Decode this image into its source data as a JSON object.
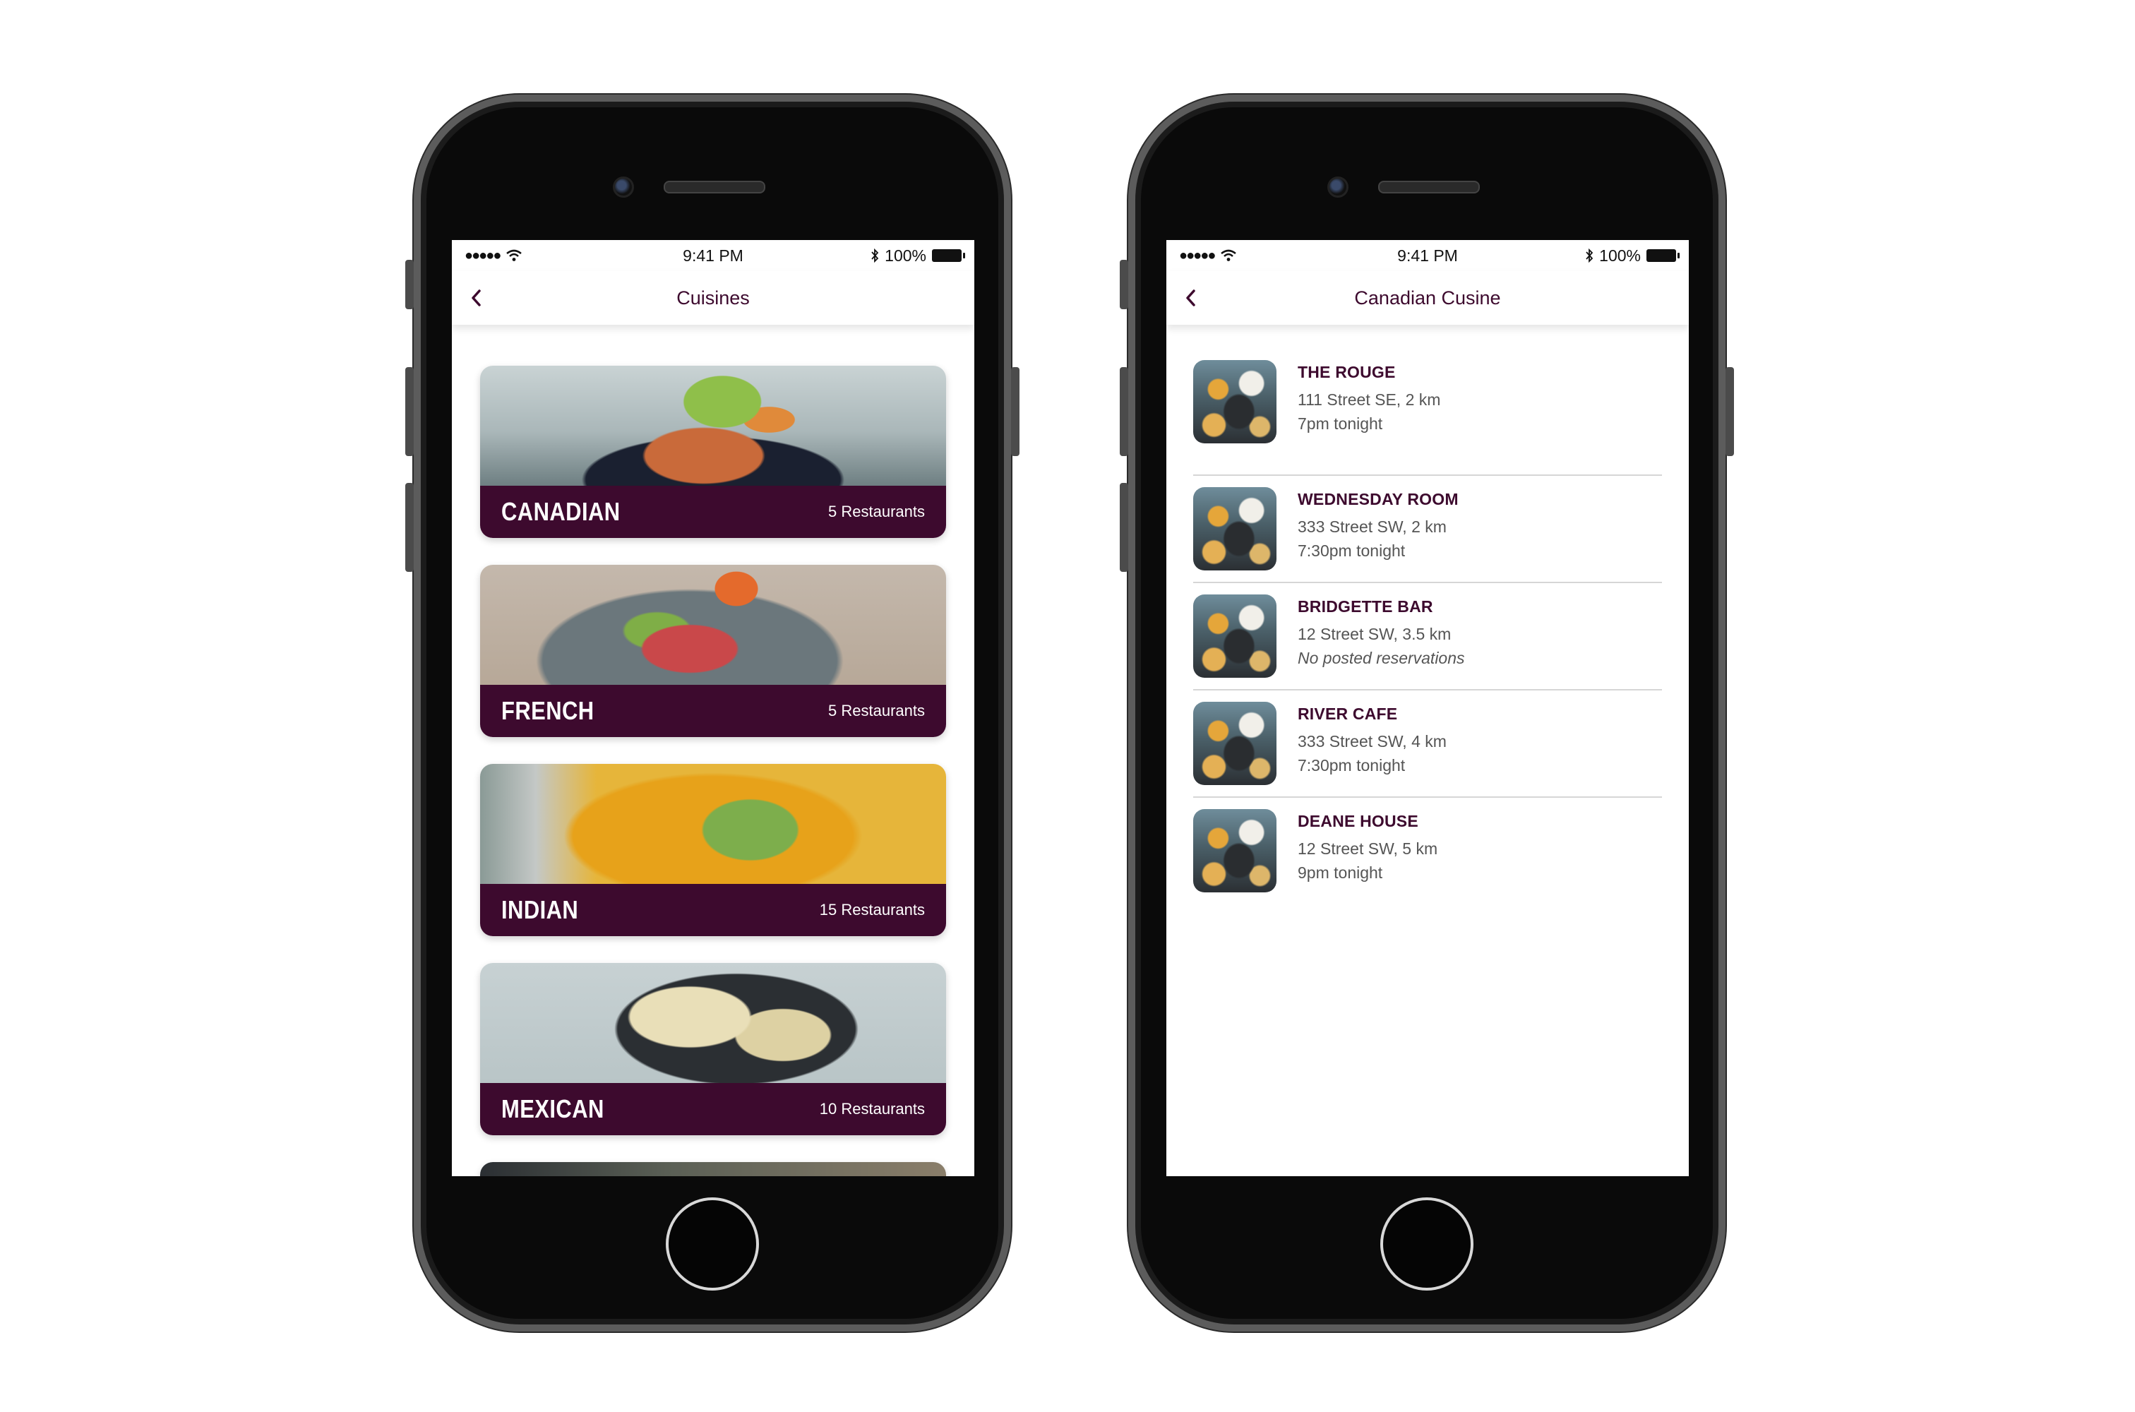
{
  "status_bar": {
    "signal": "●●●●●",
    "time": "9:41 PM",
    "battery": "100%"
  },
  "cuisines_screen": {
    "title": "Cuisines",
    "cards": [
      {
        "name": "CANADIAN",
        "count": "5 Restaurants"
      },
      {
        "name": "FRENCH",
        "count": "5 Restaurants"
      },
      {
        "name": "INDIAN",
        "count": "15 Restaurants"
      },
      {
        "name": "MEXICAN",
        "count": "10 Restaurants"
      }
    ]
  },
  "restaurants_screen": {
    "title": "Canadian Cusine",
    "restaurants": [
      {
        "name": "THE ROUGE",
        "address": "111 Street SE, 2 km",
        "time": "7pm tonight"
      },
      {
        "name": "WEDNESDAY ROOM",
        "address": "333 Street SW, 2 km",
        "time": "7:30pm tonight"
      },
      {
        "name": "BRIDGETTE BAR",
        "address": "12 Street SW, 3.5 km",
        "time": "No posted reservations"
      },
      {
        "name": "RIVER CAFE",
        "address": "333 Street SW, 4 km",
        "time": "7:30pm tonight"
      },
      {
        "name": "DEANE HOUSE",
        "address": "12 Street SW, 5 km",
        "time": "9pm tonight"
      }
    ]
  },
  "colors": {
    "brand": "#3d0a2e",
    "text_secondary": "#555555"
  },
  "icons": [
    "back-chevron-icon",
    "wifi-icon",
    "bluetooth-icon",
    "battery-icon"
  ]
}
